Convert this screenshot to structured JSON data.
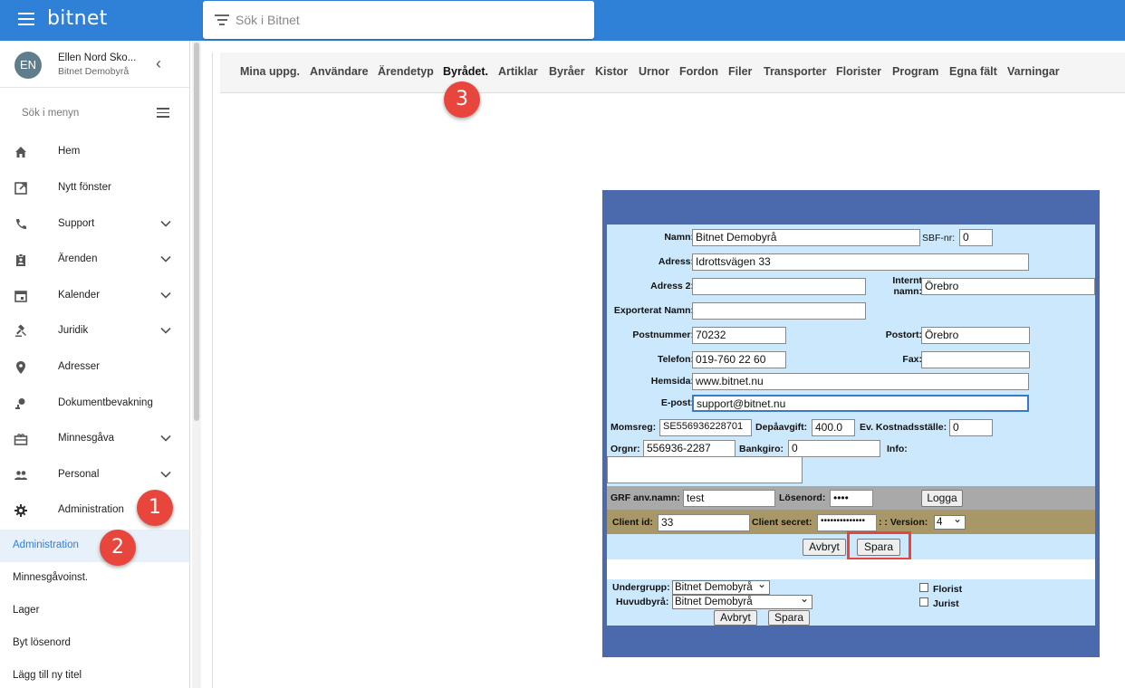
{
  "topbar": {
    "brand": "bitnet",
    "search_placeholder": "Sök i Bitnet"
  },
  "user": {
    "initials": "EN",
    "name": "Ellen Nord Sko...",
    "org": "Bitnet Demobyrå"
  },
  "menu_search": "Sök i menyn",
  "nav": [
    {
      "label": "Hem",
      "icon": "home-icon"
    },
    {
      "label": "Nytt fönster",
      "icon": "open-in-new-icon"
    },
    {
      "label": "Support",
      "icon": "phone-icon"
    },
    {
      "label": "Ärenden",
      "icon": "clipboard-icon"
    },
    {
      "label": "Kalender",
      "icon": "calendar-icon"
    },
    {
      "label": "Juridik",
      "icon": "gavel-icon"
    },
    {
      "label": "Adresser",
      "icon": "location-pin-icon"
    },
    {
      "label": "Dokumentbevakning",
      "icon": "document-watch-icon"
    },
    {
      "label": "Minnesgåva",
      "icon": "gift-card-icon"
    },
    {
      "label": "Personal",
      "icon": "people-icon"
    },
    {
      "label": "Administration",
      "icon": "gear-icon"
    }
  ],
  "subnav": [
    "Administration",
    "Minnesgåvoinst.",
    "Lager",
    "Byt lösenord",
    "Lägg till ny titel"
  ],
  "tabs": [
    "Mina uppg.",
    "Användare",
    "Ärendetyp",
    "Byrådet.",
    "Artiklar",
    "Byråer",
    "Kistor",
    "Urnor",
    "Fordon",
    "Filer",
    "Transporter",
    "Florister",
    "Program",
    "Egna fält",
    "Varningar"
  ],
  "badges": [
    "1",
    "2",
    "3"
  ],
  "form": {
    "namn_label": "Namn:",
    "namn": "Bitnet Demobyrå",
    "sbf_label": "SBF-nr:",
    "sbf": "0",
    "adress_label": "Adress:",
    "adress": "Idrottsvägen 33",
    "adress2_label": "Adress 2:",
    "adress2": "",
    "internt_label_1": "Internt",
    "internt_label_2": "namn:",
    "internt": "Örebro",
    "exporterat_label": "Exporterat Namn:",
    "exporterat": "",
    "postnummer_label": "Postnummer:",
    "postnummer": "70232",
    "postort_label": "Postort:",
    "postort": "Örebro",
    "telefon_label": "Telefon:",
    "telefon": "019-760 22 60",
    "fax_label": "Fax:",
    "fax": "",
    "hemsida_label": "Hemsida:",
    "hemsida": "www.bitnet.nu",
    "epost_label": "E-post:",
    "epost": "support@bitnet.nu",
    "momsreg_label": "Momsreg:",
    "momsreg": "SE556936228701",
    "depa_label": "Depåavgift:",
    "depa": "400.0",
    "kostnad_label": "Ev. Kostnadsställe:",
    "kostnad": "0",
    "orgnr_label": "Orgnr:",
    "orgnr": "556936-2287",
    "bankgiro_label": "Bankgiro:",
    "bankgiro": "0",
    "info_label": "Info:",
    "grf_label": "GRF anv.namn:",
    "grf": "test",
    "losen_label": "Lösenord:",
    "losen": "••••",
    "logga_label": "Logga",
    "client_id_label": "Client id:",
    "client_id": "33",
    "client_secret_label": "Client secret:",
    "client_secret": "••••••••••••••",
    "version_label": ": : Version:",
    "version": "4",
    "avbryt_label": "Avbryt",
    "spara_label": "Spara",
    "undergrupp_label": "Undergrupp:",
    "undergrupp": "Bitnet Demobyrå",
    "huvudbyra_label": "Huvudbyrå:",
    "huvudbyra": "Bitnet Demobyrå",
    "florist_label": "Florist",
    "jurist_label": "Jurist"
  }
}
